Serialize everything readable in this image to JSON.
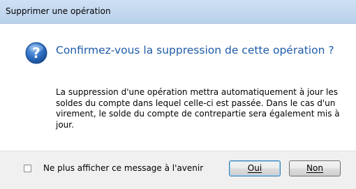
{
  "window": {
    "title": "Supprimer une opération"
  },
  "dialog": {
    "icon": "question-icon",
    "heading": "Confirmez-vous la suppression de cette opération ?",
    "message": "La suppression d'une opération mettra automatiquement à jour les soldes du compte dans lequel celle-ci est passée. Dans le cas d'un virement, le solde du compte de contrepartie sera également mis à jour."
  },
  "footer": {
    "checkbox_label": "Ne plus afficher ce message à l'avenir",
    "checkbox_checked": false,
    "yes_label": "Oui",
    "no_label": "Non"
  },
  "colors": {
    "heading": "#1e5ba8",
    "icon": "#2e6fc4",
    "titlebar": "#cfe0f3"
  }
}
